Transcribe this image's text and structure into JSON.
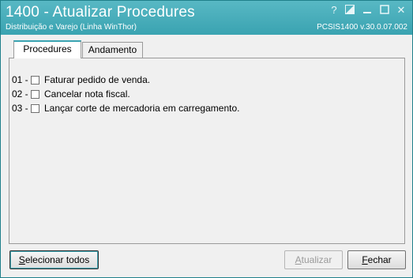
{
  "window": {
    "title": "1400 - Atualizar Procedures",
    "subtitle": "Distribuição e Varejo (Linha WinThor)",
    "version": "PCSIS1400  v.30.0.07.002",
    "controls": {
      "help": "?",
      "restore_icon": "restore-icon",
      "minimize_icon": "minimize-icon",
      "maximize_icon": "maximize-icon",
      "close": "✕"
    },
    "accent": "#3aa3b1"
  },
  "tabs": [
    {
      "label": "Procedures",
      "active": true
    },
    {
      "label": "Andamento",
      "active": false
    }
  ],
  "procedures": [
    {
      "number": "01 -",
      "label": "Faturar pedido de venda.",
      "checked": false
    },
    {
      "number": "02 -",
      "label": "Cancelar nota fiscal.",
      "checked": false
    },
    {
      "number": "03 -",
      "label": "Lançar corte de mercadoria em carregamento.",
      "checked": false
    }
  ],
  "buttons": {
    "select_all": {
      "mnemonic": "S",
      "rest": "elecionar todos"
    },
    "update": {
      "mnemonic": "A",
      "rest": "tualizar",
      "enabled": false
    },
    "close": {
      "mnemonic": "F",
      "rest": "echar"
    }
  }
}
